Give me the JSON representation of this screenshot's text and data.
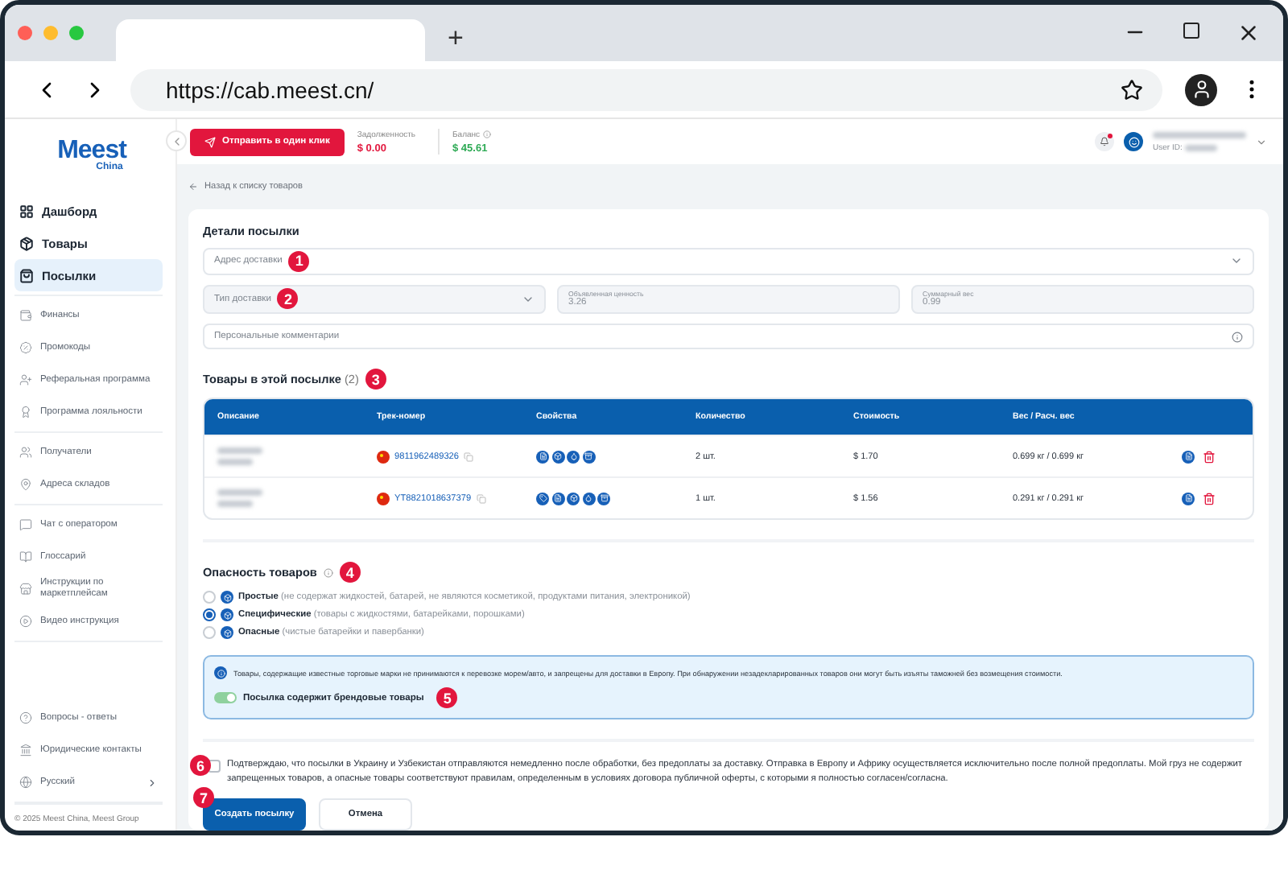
{
  "browser": {
    "new_tab": "+",
    "url": "https://cab.meest.cn/"
  },
  "sidebar": {
    "logo": {
      "brand": "Meest",
      "sub": "China"
    },
    "groups": [
      {
        "kind": "primary",
        "items": [
          {
            "label": "Дашборд",
            "selected": false
          },
          {
            "label": "Товары",
            "selected": false
          },
          {
            "label": "Посылки",
            "selected": true
          }
        ]
      },
      {
        "kind": "secondary",
        "items": [
          {
            "label": "Финансы",
            "selected": false
          },
          {
            "label": "Промокоды",
            "selected": false
          },
          {
            "label": "Реферальная программа",
            "selected": false
          },
          {
            "label": "Программа лояльности",
            "selected": false
          }
        ]
      },
      {
        "kind": "secondary",
        "items": [
          {
            "label": "Получатели",
            "selected": false
          },
          {
            "label": "Адреса складов",
            "selected": false
          }
        ]
      },
      {
        "kind": "secondary",
        "items": [
          {
            "label": "Чат с оператором",
            "selected": false
          },
          {
            "label": "Глоссарий",
            "selected": false
          },
          {
            "label": "Инструкции по маркетплейсам",
            "selected": false
          },
          {
            "label": "Видео инструкция",
            "selected": false
          }
        ]
      }
    ],
    "bottom_items": [
      {
        "label": "Вопросы - ответы",
        "selected": false
      },
      {
        "label": "Юридические контакты",
        "selected": false
      }
    ],
    "language": "Русский",
    "footer": "© 2025 Meest China, Meest Group"
  },
  "header": {
    "send_button": "Отправить в один клик",
    "debt": {
      "label": "Задолженность",
      "value": "$ 0.00"
    },
    "balance": {
      "label": "Баланс",
      "value": "$ 45.61"
    },
    "user": {
      "id_label": "User ID:"
    }
  },
  "back_link": "Назад к списку товаров",
  "details": {
    "title": "Детали посылки",
    "address": {
      "placeholder": "Адрес доставки",
      "marker": "1"
    },
    "delivery_type": {
      "placeholder": "Тип доставки",
      "marker": "2"
    },
    "declared_value": {
      "label": "Объявленная ценность",
      "value": "3.26"
    },
    "total_weight": {
      "label": "Суммарный вес",
      "value": "0.99"
    },
    "comments": {
      "placeholder": "Персональные комментарии"
    }
  },
  "goods": {
    "title": "Товары в этой посылке",
    "count": "(2)",
    "marker": "3",
    "columns": [
      "Описание",
      "Трек-номер",
      "Свойства",
      "Количество",
      "Стоимость",
      "Вес / Расч. вес"
    ],
    "rows": [
      {
        "track": "9811962489326",
        "properties": [
          {
            "kind": "doc"
          },
          {
            "kind": "cube"
          },
          {
            "kind": "drop"
          },
          {
            "kind": "box"
          }
        ],
        "quantity": "2 шт.",
        "cost": "$ 1.70",
        "weight": "0.699 кг / 0.699 кг"
      },
      {
        "track": "YT8821018637379",
        "properties": [
          {
            "kind": "tag"
          },
          {
            "kind": "doc"
          },
          {
            "kind": "cube"
          },
          {
            "kind": "drop"
          },
          {
            "kind": "box"
          }
        ],
        "quantity": "1 шт.",
        "cost": "$ 1.56",
        "weight": "0.291 кг / 0.291 кг"
      }
    ]
  },
  "danger": {
    "title": "Опасность товаров",
    "marker": "4",
    "options": [
      {
        "name": "Простые",
        "note": "(не содержат жидкостей, батарей, не являются косметикой, продуктами питания, электроникой)",
        "selected": false
      },
      {
        "name": "Специфические",
        "note": "(товары с жидкостями, батарейками, порошками)",
        "selected": true
      },
      {
        "name": "Опасные",
        "note": "(чистые батарейки и павербанки)",
        "selected": false
      }
    ],
    "notice": "Товары, содержащие известные торговые марки не принимаются к перевозке морем/авто, и запрещены для доставки в Европу. При обнаружении незадекларированных товаров они могут быть изъяты таможней без возмещения стоимости.",
    "brand_toggle": {
      "label": "Посылка содержит брендовые товары",
      "on": true,
      "marker": "5"
    }
  },
  "consent": {
    "text": "Подтверждаю, что посылки в Украину и Узбекистан отправляются немедленно после обработки, без предоплаты за доставку. Отправка в Европу и Африку осуществляется исключительно после полной предоплаты. Мой груз не содержит запрещенных товаров, а опасные товары соответствуют правилам, определенным в условиях договора публичной оферты, с которыми я полностью согласен/согласна.",
    "checked": false,
    "marker": "6"
  },
  "actions": {
    "marker": "7",
    "create": "Создать посылку",
    "cancel": "Отмена"
  }
}
